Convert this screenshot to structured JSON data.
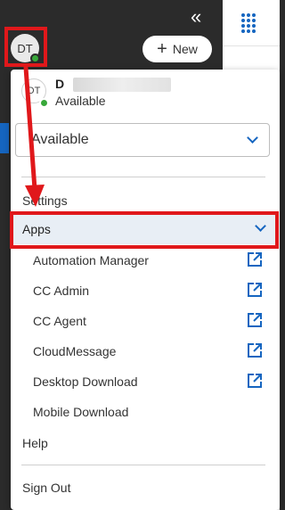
{
  "header": {
    "collapse_icon": "double-chevron-left-icon",
    "new_button_label": "New",
    "apps_grid_icon": "grid-dots-icon"
  },
  "user": {
    "initials": "DT",
    "name_visible": "D",
    "status": "Available"
  },
  "status_select": {
    "value": "Available"
  },
  "menu": {
    "settings_label": "Settings",
    "apps_label": "Apps",
    "apps_items": [
      {
        "label": "Automation Manager",
        "external": true
      },
      {
        "label": "CC Admin",
        "external": true
      },
      {
        "label": "CC Agent",
        "external": true
      },
      {
        "label": "CloudMessage",
        "external": true
      },
      {
        "label": "Desktop Download",
        "external": true
      },
      {
        "label": "Mobile Download",
        "external": false
      }
    ],
    "help_label": "Help",
    "sign_out_label": "Sign Out"
  },
  "colors": {
    "accent": "#1565c0",
    "presence": "#38a83a",
    "highlight": "#e0181b",
    "sidebar": "#2b2b2b"
  }
}
